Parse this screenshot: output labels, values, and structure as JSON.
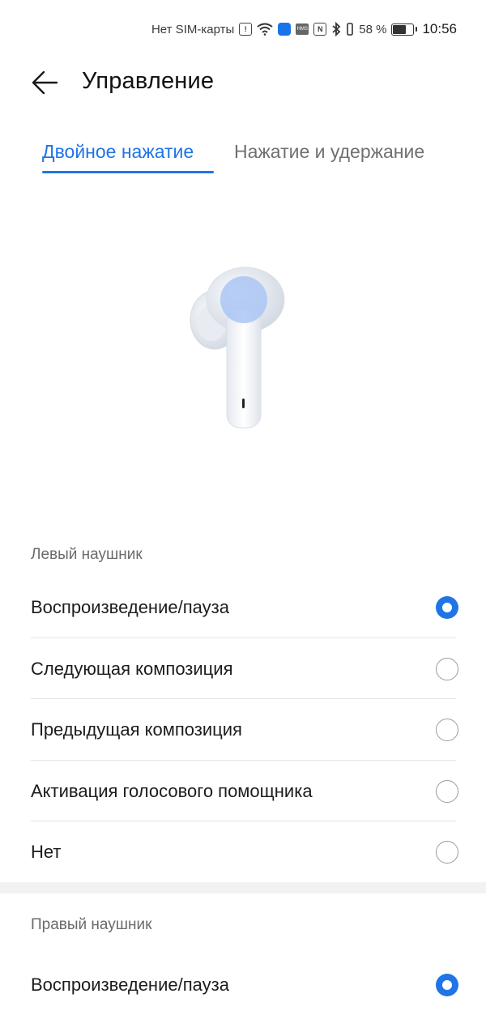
{
  "status_bar": {
    "sim": "Нет SIM-карты",
    "battery": "58 %",
    "battery_level": 0.58,
    "time": "10:56",
    "icons": [
      "alert-icon",
      "wifi-icon",
      "app-notification-icon",
      "hms-icon",
      "nfc-icon",
      "bluetooth-icon",
      "vibrate-icon",
      "battery-icon"
    ]
  },
  "header": {
    "back_icon": "arrow-left-icon",
    "title": "Управление"
  },
  "tabs": [
    {
      "label": "Двойное нажатие",
      "active": true
    },
    {
      "label": "Нажатие и удержание",
      "active": false
    }
  ],
  "colors": {
    "accent": "#1f74e6",
    "text": "#1c1c1c",
    "secondary": "#6b6b6b"
  },
  "left": {
    "label": "Левый наушник",
    "options": [
      {
        "label": "Воспроизведение/пауза",
        "selected": true
      },
      {
        "label": "Следующая композиция",
        "selected": false
      },
      {
        "label": "Предыдущая композиция",
        "selected": false
      },
      {
        "label": "Активация голосового помощника",
        "selected": false
      },
      {
        "label": "Нет",
        "selected": false
      }
    ]
  },
  "right": {
    "label": "Правый наушник",
    "options": [
      {
        "label": "Воспроизведение/пауза",
        "selected": true
      }
    ]
  }
}
